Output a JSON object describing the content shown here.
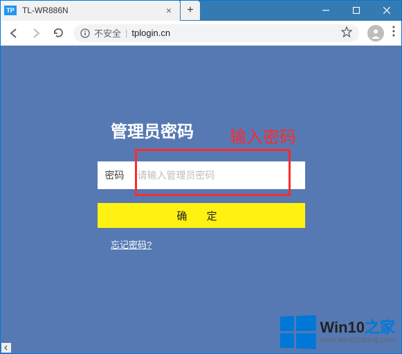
{
  "window": {
    "tab_title": "TL-WR886N",
    "favicon_text": "TP"
  },
  "address_bar": {
    "insecure_label": "不安全",
    "url": "tplogin.cn"
  },
  "login": {
    "title": "管理员密码",
    "password_label": "密码",
    "password_placeholder": "请输入管理员密码",
    "confirm_label": "确  定",
    "forgot_label": "忘记密码?"
  },
  "annotation": {
    "label": "输入密码"
  },
  "watermark": {
    "brand": "Win10",
    "brand_zh": "之家",
    "url": "www.win10xitong.com"
  }
}
